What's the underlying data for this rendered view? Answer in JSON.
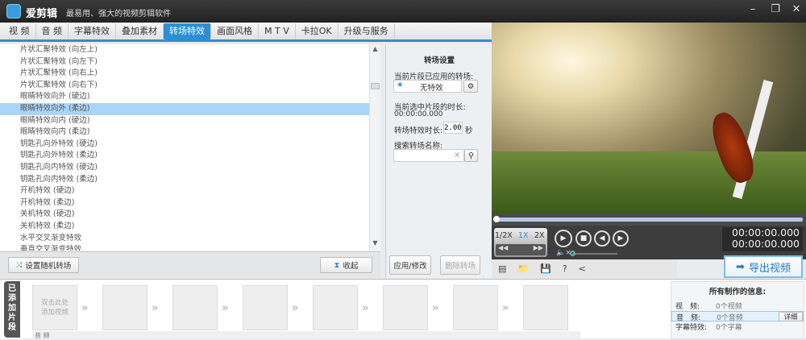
{
  "title": {
    "app": "爱剪辑",
    "slogan": "最易用、强大的视频剪辑软件"
  },
  "tabs": [
    "视 频",
    "音 频",
    "字幕特效",
    "叠加素材",
    "转场特效",
    "画面风格",
    "M T V",
    "卡拉OK",
    "升级与服务"
  ],
  "active_tab": 4,
  "transitions": [
    "片状汇聚特效 (向左上)",
    "片状汇聚特效 (向左下)",
    "片状汇聚特效 (向右上)",
    "片状汇聚特效 (向右下)",
    "眼睛特效向外 (硬边)",
    "眼睛特效向外 (柔边)",
    "眼睛特效向内 (硬边)",
    "眼睛特效向内 (柔边)",
    "钥匙孔向外特效 (硬边)",
    "钥匙孔向外特效 (柔边)",
    "钥匙孔向内特效 (硬边)",
    "钥匙孔向内特效 (柔边)",
    "开机特效 (硬边)",
    "开机特效 (柔边)",
    "关机特效 (硬边)",
    "关机特效 (柔边)",
    "水平交叉渐变特效",
    "垂直交叉渐变特效"
  ],
  "selected_index": 5,
  "left_buttons": {
    "random": "设置随机转场",
    "collapse": "收起"
  },
  "settings": {
    "header": "转场设置",
    "applied_label": "当前片段已应用的转场:",
    "applied_value": "无特效",
    "duration_label": "当前选中片段的时长:",
    "duration_value": "00:00:00.000",
    "effect_len_label": "转场特效时长:",
    "effect_len_value": "2.00",
    "effect_len_unit": "秒",
    "search_label": "搜索转场名称:",
    "search_value": "",
    "apply": "应用/修改",
    "delete": "删除转场"
  },
  "player": {
    "speeds": [
      "1/2X",
      "1X",
      "2X"
    ],
    "speed_active": "1X",
    "time_current": "00:00:00.000",
    "time_total": "00:00:00.000",
    "progress": 0,
    "volume": 0
  },
  "export": "导出视频",
  "timeline": {
    "tab": "已添加片段",
    "placeholder": "双击此处添加视频",
    "audio_label": "音 频"
  },
  "info": {
    "title": "所有制作的信息:",
    "rows": [
      {
        "k": "视　频:",
        "v": "0个视频"
      },
      {
        "k": "音　频:",
        "v": "0个音频"
      },
      {
        "k": "字幕特效:",
        "v": "0个字幕"
      }
    ],
    "detail": "详细"
  },
  "colors": {
    "accent": "#2b8fd8",
    "selection": "#a9d5f7"
  }
}
